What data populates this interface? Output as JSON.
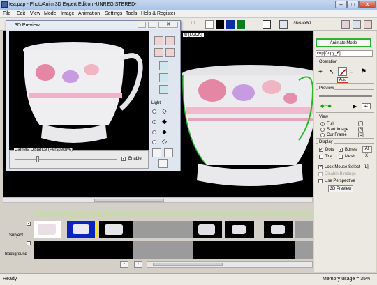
{
  "window": {
    "title": "tea.pap - PhotoAnim 3D Expert Edition -UNREGISTERED-"
  },
  "menu": [
    "File",
    "Edit",
    "View",
    "Mode",
    "Image",
    "Animation",
    "Settings",
    "Tools",
    "Help & Register"
  ],
  "toolbar": {
    "zoom_label": "1:1",
    "label_3ds_obj": "3DS OBJ"
  },
  "canvas": {
    "status_text": "w  [LOCK]"
  },
  "preview": {
    "title": "3D Preview",
    "light_label": "Light",
    "camera_label": "Camera Distance (Perspective)",
    "enable_label": "Enable"
  },
  "panel": {
    "animate_mode": "Animate Mode",
    "object_name": "cup[Copy_6]",
    "operation_label": "Operation",
    "auto_label": "Auto",
    "preview_label": "Preview",
    "view_label": "View",
    "view_options": [
      {
        "label": "Full",
        "key": "[F]"
      },
      {
        "label": "Start Image",
        "key": "[S]"
      },
      {
        "label": "Cur Frame",
        "key": "[C]"
      }
    ],
    "display_label": "Display",
    "dots_label": "Dots",
    "bones_label": "Bones",
    "all_label": "All",
    "traj_label": "Traj.",
    "mesh_label": "Mesh",
    "x_label": "X",
    "lock_mouse_label": "Lock Mouse Select",
    "lock_mouse_key": "[L]",
    "disable_bindings_label": "Disable Bindings",
    "use_perspective_label": "Use Perspective",
    "preview_3d_button": "3D Preview"
  },
  "timeline": {
    "subject_label": "Subject",
    "background_label": "Background",
    "minus": "-",
    "plus": "+"
  },
  "status": {
    "left": "Ready",
    "memory": "Memory usage = 35%"
  },
  "colors": {
    "accent_green": "#2bb52b",
    "selection_blue": "#0a24c4",
    "title_blue": "#b3cbe8"
  }
}
